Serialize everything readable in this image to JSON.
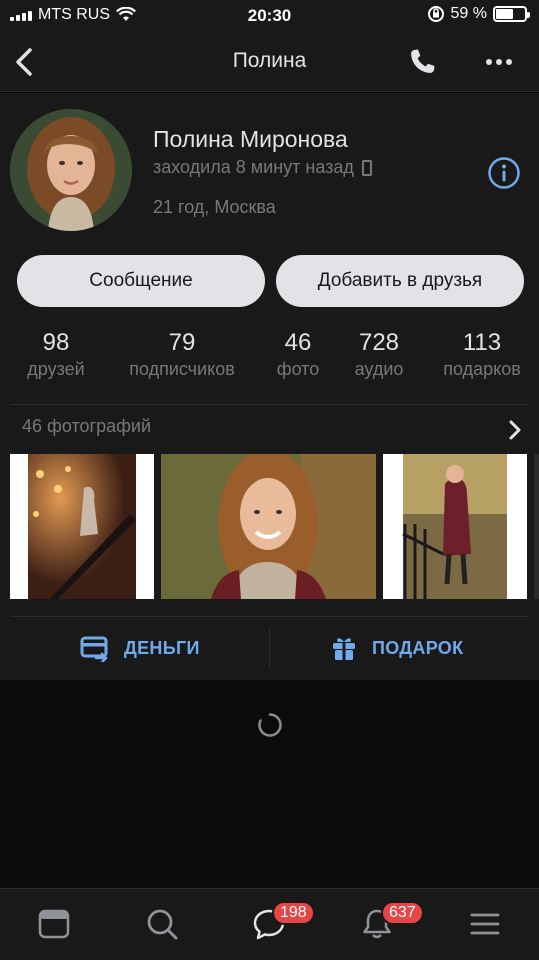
{
  "status_bar": {
    "carrier": "MTS RUS",
    "time": "20:30",
    "battery": "59 %",
    "battery_level": 0.59
  },
  "navbar": {
    "title": "Полина"
  },
  "profile": {
    "name": "Полина Миронова",
    "online_status": "заходила 8 минут назад",
    "info_line": "21 год, Москва",
    "message_button": "Сообщение",
    "add_friend_button": "Добавить в друзья",
    "counters": [
      {
        "value": "98",
        "label": "друзей"
      },
      {
        "value": "79",
        "label": "подписчиков"
      },
      {
        "value": "46",
        "label": "фото"
      },
      {
        "value": "728",
        "label": "аудио"
      },
      {
        "value": "113",
        "label": "подарков"
      }
    ]
  },
  "photos": {
    "header": "46 фотографий"
  },
  "actions": {
    "money": "ДЕНЬГИ",
    "gift": "ПОДАРОК"
  },
  "tabbar": {
    "messages_badge": "198",
    "notifications_badge": "637"
  },
  "colors": {
    "accent": "#71aaeb",
    "badge": "#e64646",
    "card_bg": "#19191a",
    "page_bg": "#0b0b0c"
  },
  "icons": [
    "back-chevron-icon",
    "phone-icon",
    "more-icon",
    "info-icon",
    "mobile-icon",
    "chevron-right-icon",
    "wallet-icon",
    "gift-icon",
    "spinner-icon",
    "news-icon",
    "search-icon",
    "messages-icon",
    "bell-icon",
    "menu-icon"
  ]
}
